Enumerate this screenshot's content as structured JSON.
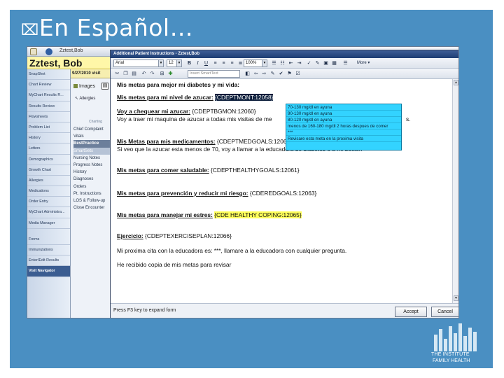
{
  "slide": {
    "title": "En Español…",
    "bullet_glyph": "⌧"
  },
  "ehr": {
    "topbar_text": "Zztest,Bob",
    "patient_name": "Zztest, Bob",
    "visit_date": "9/27/2010 visit",
    "nav_items": [
      "SnapShot",
      "Chart Review",
      "MyChart Results R...",
      "Results Review",
      "Flowsheets",
      "Problem List",
      "History",
      "Letters",
      "Demographics",
      "Growth Chart",
      "Allergies",
      "Medications",
      "Order Entry",
      "MyChart Administra...",
      "Media Manager",
      "Forms",
      "Immunizations",
      "Enter/Edit Results",
      "Visit Navigator"
    ],
    "images_label": "Images",
    "allergies_label": "Allergies",
    "charting_label": "Charting",
    "charting_items": [
      "Chief Complaint",
      "Vitals",
      "BestPractice",
      "SmartSets",
      "Nursing Notes",
      "Progress Notes",
      "History",
      "Diagnoses",
      "Orders",
      "Pt. Instructions",
      "LOS & Follow-up",
      "Close Encounter"
    ]
  },
  "dialog": {
    "title": "Additional Patient Instructions - Zztest,Bob",
    "font_name": "Arial",
    "font_size": "12",
    "zoom": "100%",
    "smarttext_placeholder": "Insert SmartText",
    "more_label": "More",
    "lines": [
      {
        "label": "Mis metas para mejor mi diabetes y mi vida:",
        "rest": ""
      },
      {
        "label": "Mis metas para mi nivel de azucar:",
        "code": "{CDEPTMONT:12058}"
      },
      {
        "label": "Voy a chequear mi azucar:",
        "rest": " {CDEPTBGMON:12060}"
      },
      {
        "text": "Voy a traer mi maquina de azucar a todas mis visitas de me"
      },
      {
        "text_tail": "s."
      },
      {
        "label": "Mis Metas para mis medicamentos:",
        "rest": " {CDEPTMEDGOALS:12062}"
      },
      {
        "text": "Si veo que la azucar esta menos de 70, voy a llamar a la educadora de diabetes o a mi doctor."
      },
      {
        "label": "Mis metas para comer saludable:",
        "rest": " {CDEPTHEALTHYGOALS:12061}"
      },
      {
        "label": "Mis metas para prevención y reducir mi riesgo:",
        "rest": " {CDEREDGOALS:12063}"
      },
      {
        "label": "Mis metas para manejar mi estres:",
        "code": "{CDE HEALTHY COPING:12065}"
      },
      {
        "label": "Ejercicio:",
        "rest": " {CDEPTEXERCISEPLAN:12066}"
      },
      {
        "text": "Mi proxima cita con la educadora es: ***, llamare a la educadora con cualquier pregunta."
      },
      {
        "text": "He recibido copia de mis metas para revisar"
      }
    ],
    "popup_options": [
      "70-130 mg/dl en ayuna",
      "90-130 mg/dl en ayuna",
      "80-120 mg/dl en ayuna",
      "menos de 160-180 mg/dl 2 horas despues de comer",
      "***",
      "Revisare esta meta en la proxima visita"
    ],
    "footer_hint": "Press F3 key to expand form",
    "accept_label": "Accept",
    "cancel_label": "Cancel"
  },
  "logo": {
    "line1": "THE INSTITUTE",
    "line2": "FAMILY HEALTH"
  },
  "colors": {
    "slide_bg": "#4a8fc2",
    "popup_bg": "#33d3ff",
    "highlight": "#ffff5a"
  }
}
